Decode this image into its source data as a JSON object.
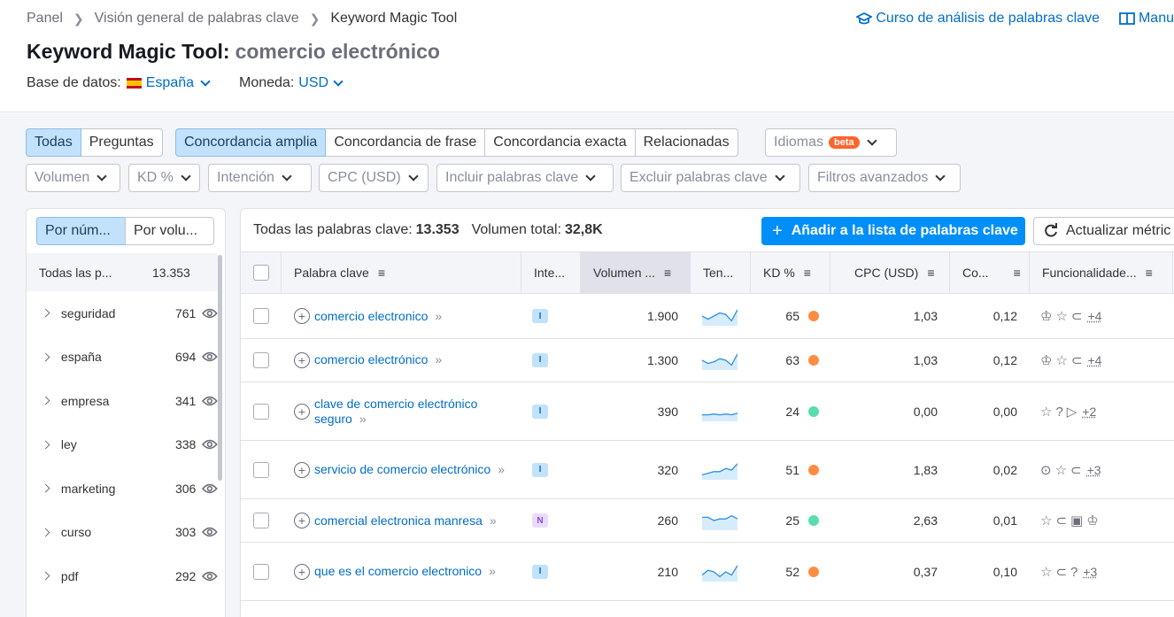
{
  "breadcrumb": [
    "Panel",
    "Visión general de palabras clave",
    "Keyword Magic Tool"
  ],
  "top_links": {
    "course": "Curso de análisis de palabras clave",
    "manual": "Manu"
  },
  "title": {
    "tool": "Keyword Magic Tool:",
    "query": "comercio electrónico"
  },
  "database": {
    "label": "Base de datos:",
    "value": "España",
    "currency_label": "Moneda:",
    "currency": "USD"
  },
  "match_tabs": {
    "all": "Todas",
    "questions": "Preguntas",
    "broad": "Concordancia amplia",
    "phrase": "Concordancia de frase",
    "exact": "Concordancia exacta",
    "related": "Relacionadas"
  },
  "languages": {
    "label": "Idiomas",
    "badge": "beta"
  },
  "filters": [
    "Volumen",
    "KD %",
    "Intención",
    "CPC (USD)",
    "Incluir palabras clave",
    "Excluir palabras clave",
    "Filtros avanzados"
  ],
  "sidebar": {
    "tab_number": "Por núm...",
    "tab_volume": "Por volu...",
    "all_label": "Todas las p...",
    "all_count": "13.353",
    "items": [
      {
        "label": "seguridad",
        "count": "761"
      },
      {
        "label": "españa",
        "count": "694"
      },
      {
        "label": "empresa",
        "count": "341"
      },
      {
        "label": "ley",
        "count": "338"
      },
      {
        "label": "marketing",
        "count": "306"
      },
      {
        "label": "curso",
        "count": "303"
      },
      {
        "label": "pdf",
        "count": "292"
      }
    ]
  },
  "summary": {
    "all_label": "Todas las palabras clave:",
    "all_value": "13.353",
    "vol_label": "Volumen total:",
    "vol_value": "32,8K"
  },
  "actions": {
    "add": "Añadir a la lista de palabras clave",
    "update": "Actualizar métric"
  },
  "columns": {
    "keyword": "Palabra clave",
    "intent": "Inte...",
    "volume": "Volumen ...",
    "trend": "Ten...",
    "kd": "KD %",
    "cpc": "CPC (USD)",
    "com": "Co...",
    "features": "Funcionalidade..."
  },
  "colors": {
    "accent": "#006dca",
    "orange": "#ff8c43",
    "green": "#59ddaa",
    "primary_btn": "#008ff8"
  },
  "rows": [
    {
      "kw1": "comercio electronico",
      "kw2": "",
      "intent": "I",
      "volume": "1.900",
      "kd": "65",
      "kd_color": "orange",
      "cpc": "1,03",
      "com": "0,12",
      "features": "♔☆⊂",
      "more": "+4",
      "trend": [
        0.5,
        0.3,
        0.5,
        0.7,
        0.6,
        0.2,
        0.9
      ]
    },
    {
      "kw1": "comercio electrónico",
      "kw2": "",
      "intent": "I",
      "volume": "1.300",
      "kd": "63",
      "kd_color": "orange",
      "cpc": "1,03",
      "com": "0,12",
      "features": "♔☆⊂",
      "more": "+4",
      "trend": [
        0.5,
        0.3,
        0.4,
        0.6,
        0.5,
        0.2,
        0.9
      ]
    },
    {
      "kw1": "clave de comercio electrónico",
      "kw2": "seguro",
      "intent": "I",
      "volume": "390",
      "kd": "24",
      "kd_color": "green",
      "cpc": "0,00",
      "com": "0,00",
      "features": "☆?▷",
      "more": "+2",
      "trend": [
        0.3,
        0.3,
        0.35,
        0.3,
        0.35,
        0.3,
        0.4
      ]
    },
    {
      "kw1": "servicio de comercio electrónico",
      "kw2": "",
      "intent": "I",
      "volume": "320",
      "kd": "51",
      "kd_color": "orange",
      "cpc": "1,83",
      "com": "0,02",
      "features": "⊙☆⊂",
      "more": "+3",
      "trend": [
        0.2,
        0.3,
        0.4,
        0.4,
        0.6,
        0.5,
        0.9
      ]
    },
    {
      "kw1": "comercial electronica manresa",
      "kw2": "",
      "intent": "N",
      "volume": "260",
      "kd": "25",
      "kd_color": "green",
      "cpc": "2,63",
      "com": "0,01",
      "features": "☆⊂▣♔",
      "more": "",
      "trend": [
        0.7,
        0.7,
        0.5,
        0.6,
        0.6,
        0.8,
        0.6
      ]
    },
    {
      "kw1": "que es el comercio electronico",
      "kw2": "",
      "intent": "I",
      "volume": "210",
      "kd": "52",
      "kd_color": "orange",
      "cpc": "0,37",
      "com": "0,10",
      "features": "☆⊂?",
      "more": "+3",
      "trend": [
        0.3,
        0.6,
        0.5,
        0.2,
        0.5,
        0.3,
        0.9
      ]
    }
  ]
}
